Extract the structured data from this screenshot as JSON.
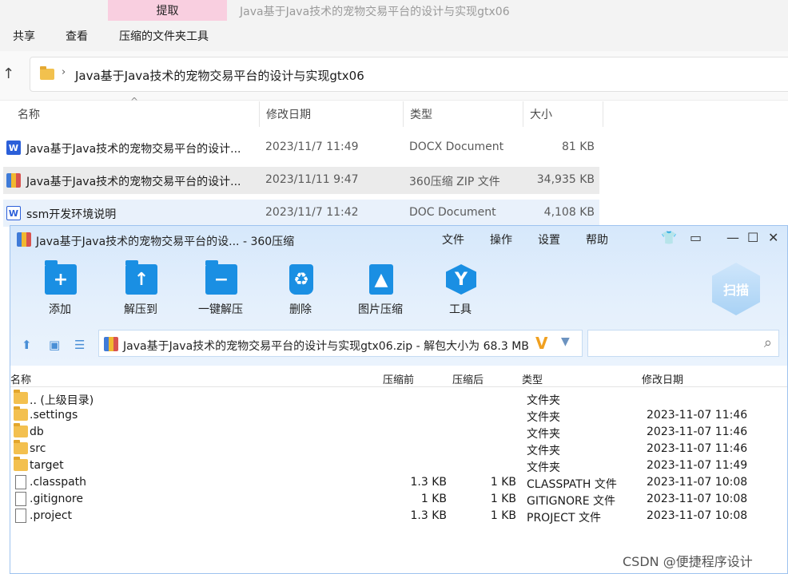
{
  "explorer": {
    "ribbon": {
      "extract_tab": "提取",
      "window_title": "Java基于Java技术的宠物交易平台的设计与实现gtx06",
      "menu": [
        "共享",
        "查看",
        "压缩的文件夹工具"
      ]
    },
    "address": {
      "path": "Java基于Java技术的宠物交易平台的设计与实现gtx06"
    },
    "columns": [
      "名称",
      "修改日期",
      "类型",
      "大小"
    ],
    "files": [
      {
        "name": "Java基于Java技术的宠物交易平台的设计...",
        "date": "2023/11/7 11:49",
        "type": "DOCX Document",
        "size": "81 KB",
        "icon": "word-doc-icon"
      },
      {
        "name": "Java基于Java技术的宠物交易平台的设计...",
        "date": "2023/11/11 9:47",
        "type": "360压缩 ZIP 文件",
        "size": "34,935 KB",
        "icon": "zip-archive-icon"
      },
      {
        "name": "ssm开发环境说明",
        "date": "2023/11/7 11:42",
        "type": "DOC Document",
        "size": "4,108 KB",
        "icon": "word-doc-icon"
      }
    ]
  },
  "zip360": {
    "title": "Java基于Java技术的宠物交易平台的设... - 360压缩",
    "menu": [
      "文件",
      "操作",
      "设置",
      "帮助"
    ],
    "toolbar": [
      "添加",
      "解压到",
      "一键解压",
      "删除",
      "图片压缩",
      "工具"
    ],
    "scan_label": "扫描",
    "path_text": "Java基于Java技术的宠物交易平台的设计与实现gtx06.zip - 解包大小为 68.3 MB",
    "columns": [
      "名称",
      "压缩前",
      "压缩后",
      "类型",
      "修改日期"
    ],
    "entries": [
      {
        "name": ".. (上级目录)",
        "before": "",
        "after": "",
        "type": "文件夹",
        "date": "",
        "kind": "dir"
      },
      {
        "name": ".settings",
        "before": "",
        "after": "",
        "type": "文件夹",
        "date": "2023-11-07 11:46",
        "kind": "dir"
      },
      {
        "name": "db",
        "before": "",
        "after": "",
        "type": "文件夹",
        "date": "2023-11-07 11:46",
        "kind": "dir"
      },
      {
        "name": "src",
        "before": "",
        "after": "",
        "type": "文件夹",
        "date": "2023-11-07 11:46",
        "kind": "dir"
      },
      {
        "name": "target",
        "before": "",
        "after": "",
        "type": "文件夹",
        "date": "2023-11-07 11:49",
        "kind": "dir"
      },
      {
        "name": ".classpath",
        "before": "1.3 KB",
        "after": "1 KB",
        "type": "CLASSPATH 文件",
        "date": "2023-11-07 10:08",
        "kind": "doc"
      },
      {
        "name": ".gitignore",
        "before": "1 KB",
        "after": "1 KB",
        "type": "GITIGNORE 文件",
        "date": "2023-11-07 10:08",
        "kind": "doc"
      },
      {
        "name": ".project",
        "before": "1.3 KB",
        "after": "1 KB",
        "type": "PROJECT 文件",
        "date": "2023-11-07 10:08",
        "kind": "doc"
      }
    ]
  },
  "watermark": "CSDN @便捷程序设计"
}
